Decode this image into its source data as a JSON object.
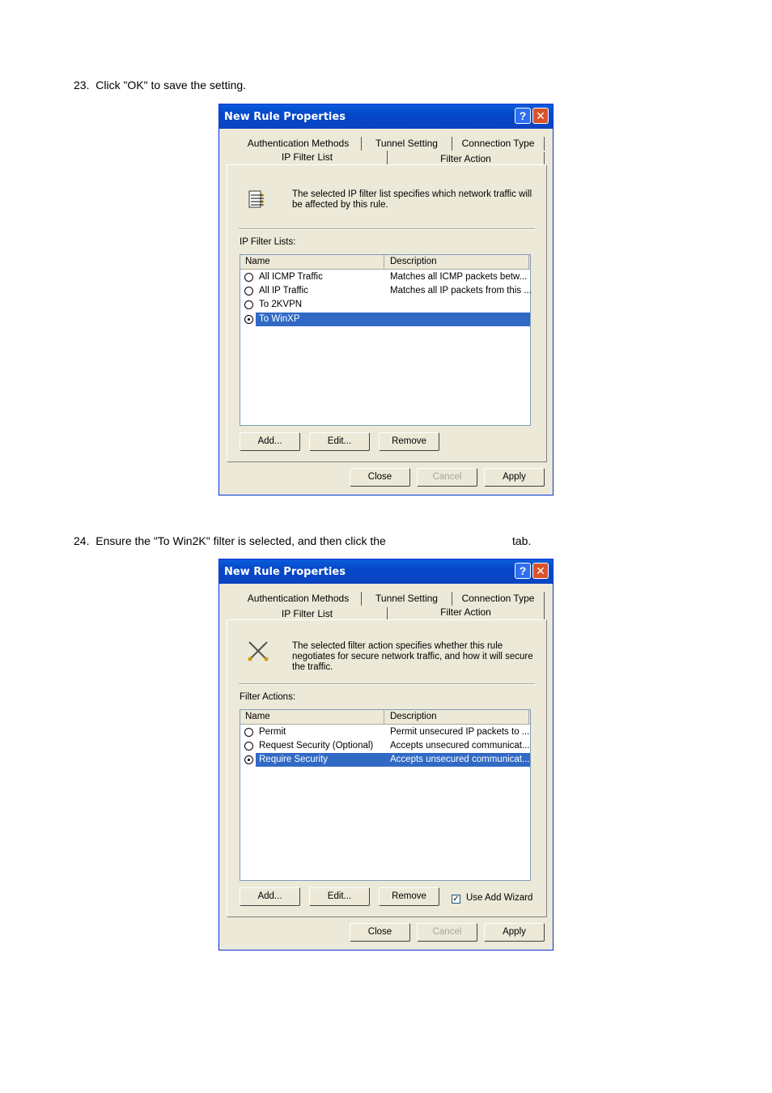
{
  "steps": [
    {
      "text": "23.  Click \"OK\" to save the setting."
    },
    {
      "text": "24.  Ensure the \"To Win2K\" filter is selected, and then click the",
      "suffix": "tab."
    }
  ],
  "dialog1": {
    "title": "New Rule Properties",
    "tabs_top": [
      "Authentication Methods",
      "Tunnel Setting",
      "Connection Type"
    ],
    "tabs_bottom": [
      "IP Filter List",
      "Filter Action"
    ],
    "info": "The selected IP filter list specifies which network traffic will be affected by this rule.",
    "list_label": "IP Filter Lists:",
    "columns": [
      "Name",
      "Description"
    ],
    "rows": [
      {
        "name": "All ICMP Traffic",
        "desc": "Matches all ICMP packets betw..."
      },
      {
        "name": "All IP Traffic",
        "desc": "Matches all IP packets from this ..."
      },
      {
        "name": "To 2KVPN",
        "desc": ""
      },
      {
        "name": "To WinXP",
        "desc": ""
      }
    ],
    "buttons": {
      "add": "Add...",
      "edit": "Edit...",
      "remove": "Remove",
      "close": "Close",
      "cancel": "Cancel",
      "apply": "Apply"
    }
  },
  "dialog2": {
    "title": "New Rule Properties",
    "tabs_top": [
      "Authentication Methods",
      "Tunnel Setting",
      "Connection Type"
    ],
    "tabs_bottom": [
      "IP Filter List",
      "Filter Action"
    ],
    "info": "The selected filter action specifies whether this rule negotiates for secure network traffic, and how it will secure the traffic.",
    "list_label": "Filter Actions:",
    "columns": [
      "Name",
      "Description"
    ],
    "rows": [
      {
        "name": "Permit",
        "desc": "Permit unsecured IP packets to ..."
      },
      {
        "name": "Request Security (Optional)",
        "desc": "Accepts unsecured communicat..."
      },
      {
        "name": "Require Security",
        "desc": "Accepts unsecured communicat..."
      }
    ],
    "checkbox_label": "Use Add Wizard",
    "buttons": {
      "add": "Add...",
      "edit": "Edit...",
      "remove": "Remove",
      "close": "Close",
      "cancel": "Cancel",
      "apply": "Apply"
    }
  }
}
